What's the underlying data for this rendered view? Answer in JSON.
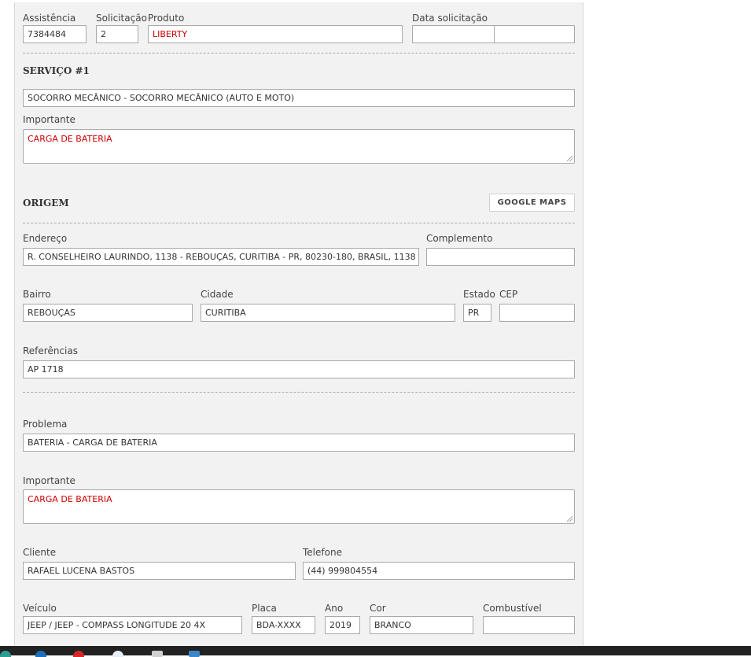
{
  "header": {
    "assistencia_label": "Assistência",
    "assistencia_value": "7384484",
    "solicitacao_label": "Solicitação",
    "solicitacao_value": "2",
    "produto_label": "Produto",
    "produto_value": "LIBERTY",
    "data_label": "Data solicitação",
    "data_value": "",
    "hora_value": ""
  },
  "servico": {
    "title": "SERVIÇO #1",
    "tipo_value": "SOCORRO MECÂNICO - SOCORRO MECÂNICO (AUTO E MOTO)",
    "importante_label": "Importante",
    "importante_value": "CARGA DE BATERIA"
  },
  "origem": {
    "title": "ORIGEM",
    "maps_button": "GOOGLE MAPS",
    "endereco_label": "Endereço",
    "endereco_value": "R. CONSELHEIRO LAURINDO, 1138 - REBOUÇAS, CURITIBA - PR, 80230-180, BRASIL, 1138",
    "complemento_label": "Complemento",
    "complemento_value": "",
    "bairro_label": "Bairro",
    "bairro_value": "REBOUÇAS",
    "cidade_label": "Cidade",
    "cidade_value": "CURITIBA",
    "estado_label": "Estado",
    "estado_value": "PR",
    "cep_label": "CEP",
    "cep_value": "",
    "referencias_label": "Referências",
    "referencias_value": "AP 1718"
  },
  "problema": {
    "problema_label": "Problema",
    "problema_value": "BATERIA - CARGA DE BATERIA",
    "importante_label": "Importante",
    "importante_value": "CARGA DE BATERIA"
  },
  "cliente": {
    "cliente_label": "Cliente",
    "cliente_value": "RAFAEL LUCENA BASTOS",
    "telefone_label": "Telefone",
    "telefone_value": "(44) 999804554"
  },
  "veiculo": {
    "veiculo_label": "Veículo",
    "veiculo_value": "JEEP / JEEP - COMPASS LONGITUDE 20 4X",
    "placa_label": "Placa",
    "placa_value": "BDA-XXXX",
    "ano_label": "Ano",
    "ano_value": "2019",
    "cor_label": "Cor",
    "cor_value": "BRANCO",
    "combustivel_label": "Combustível",
    "combustivel_value": ""
  },
  "colors": {
    "accent_red": "#cc0000",
    "panel_bg": "#f2f2f2",
    "taskbar": "#222222"
  },
  "taskbar_icons": [
    "taskbar-app-icon-1",
    "taskbar-app-icon-2",
    "taskbar-app-icon-3",
    "taskbar-app-icon-4",
    "taskbar-app-icon-5",
    "taskbar-app-icon-6"
  ]
}
